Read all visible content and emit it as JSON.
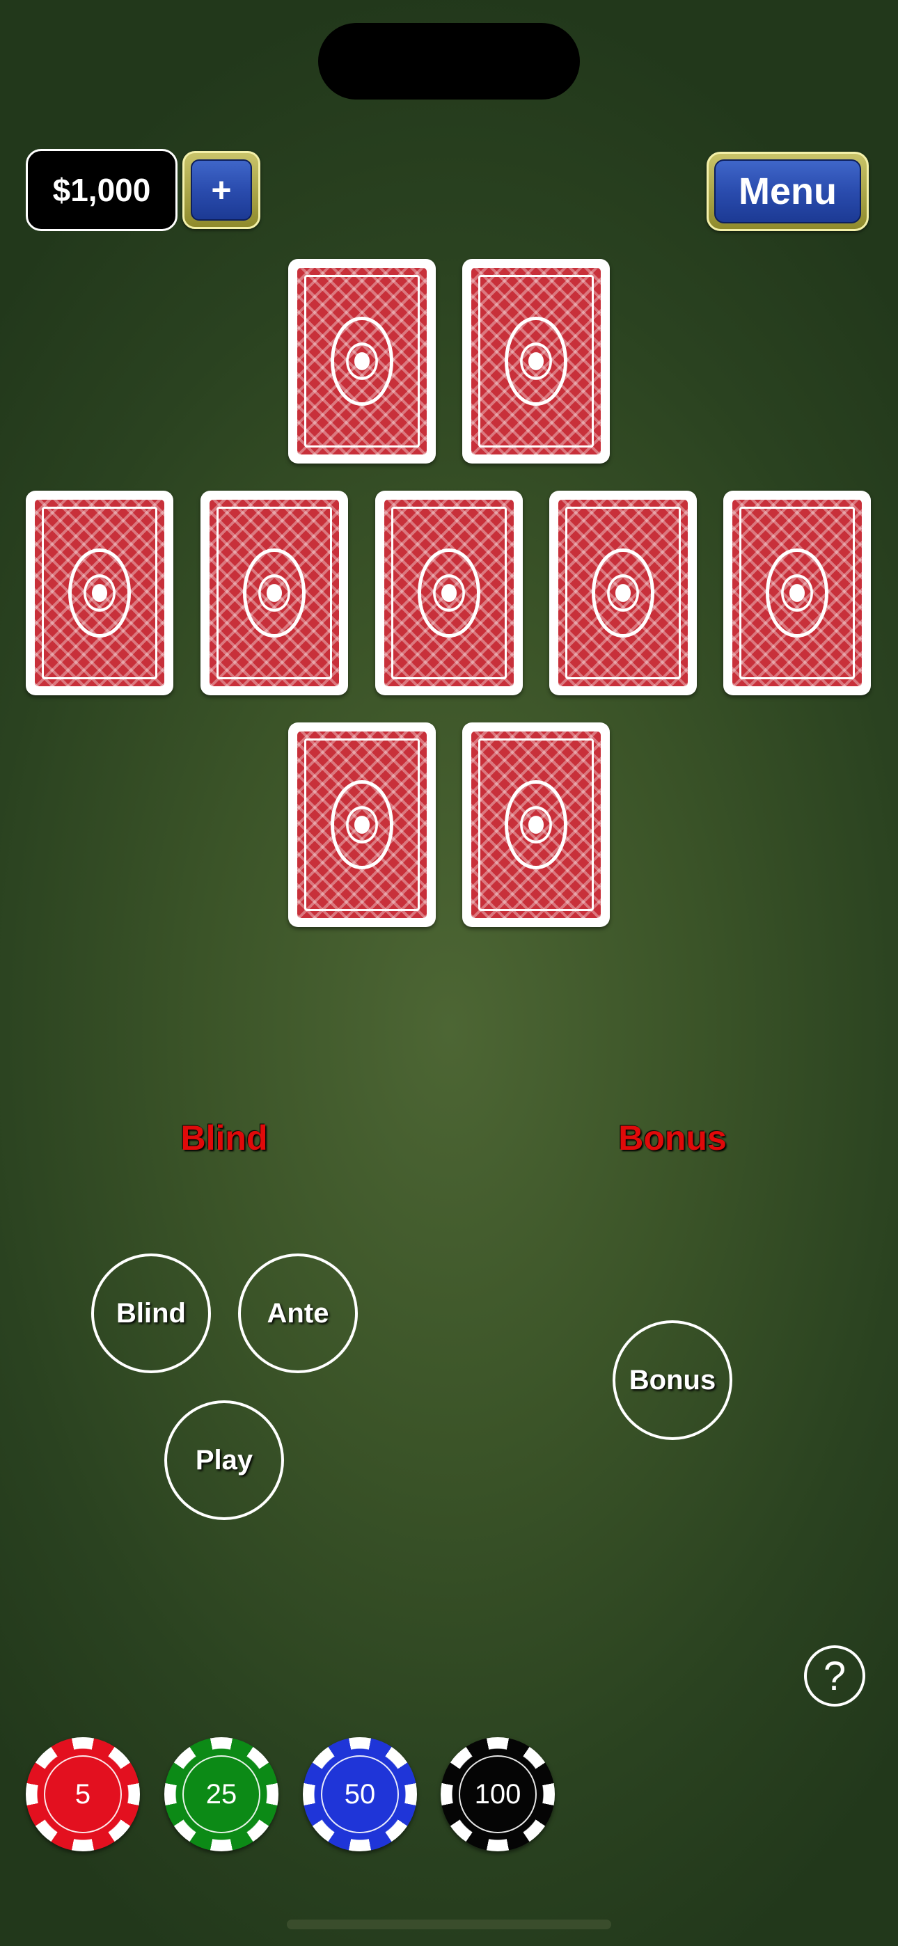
{
  "header": {
    "balance": "$1,000",
    "add_label": "+",
    "menu_label": "Menu"
  },
  "cards": {
    "dealer_count": 2,
    "community_count": 5,
    "player_count": 2,
    "state": "face-down"
  },
  "areas": {
    "left_label": "Blind",
    "right_label": "Bonus"
  },
  "bets": {
    "blind": "Blind",
    "ante": "Ante",
    "play": "Play",
    "bonus": "Bonus"
  },
  "help_label": "?",
  "chips": [
    {
      "value": "5",
      "color": "#e3101f"
    },
    {
      "value": "25",
      "color": "#0c8a16"
    },
    {
      "value": "50",
      "color": "#1f35d8"
    },
    {
      "value": "100",
      "color": "#050505"
    }
  ],
  "colors": {
    "table_felt": "#3b5428",
    "label_red": "#e00a0a",
    "button_blue": "#2a4cae",
    "button_gold": "#c9c46a",
    "card_back": "#c8303a"
  }
}
